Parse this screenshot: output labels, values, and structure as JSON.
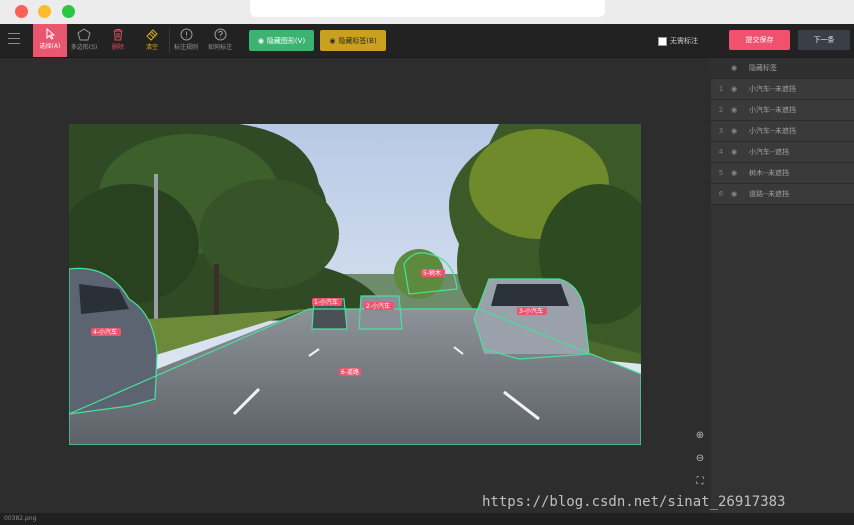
{
  "toolbar": {
    "tools": [
      {
        "label": "选择(A)"
      },
      {
        "label": "多边形(S)"
      },
      {
        "label": "删除"
      },
      {
        "label": "清空"
      },
      {
        "label": "标注规则"
      },
      {
        "label": "如何标注"
      }
    ],
    "hide_shapes_label": "隐藏图形(V)",
    "hide_labels_label": "隐藏标签(B)",
    "no_annotation_label": "无需标注",
    "submit_label": "提交保存",
    "next_label": "下一条"
  },
  "panel": {
    "header_label": "隐藏标签",
    "items": [
      {
        "index": "1",
        "label": "小汽车--未遮挡"
      },
      {
        "index": "2",
        "label": "小汽车--未遮挡"
      },
      {
        "index": "3",
        "label": "小汽车--未遮挡"
      },
      {
        "index": "4",
        "label": "小汽车--遮挡"
      },
      {
        "index": "5",
        "label": "树木--未遮挡"
      },
      {
        "index": "6",
        "label": "道路--未遮挡"
      }
    ]
  },
  "image_tags": {
    "car_left": "4-小汽车",
    "car_mid1": "1-小汽车",
    "car_mid2": "2-小汽车",
    "car_right": "3-小汽车",
    "tree": "5-树木",
    "road": "6-道路"
  },
  "status": {
    "filename": "00382.png"
  },
  "watermark": "https://blog.csdn.net/sinat_26917383",
  "colors": {
    "accent_pink": "#e9566f",
    "green_button": "#3cb371",
    "yellow_button": "#caa021",
    "annotation_outline": "#46e29a"
  }
}
